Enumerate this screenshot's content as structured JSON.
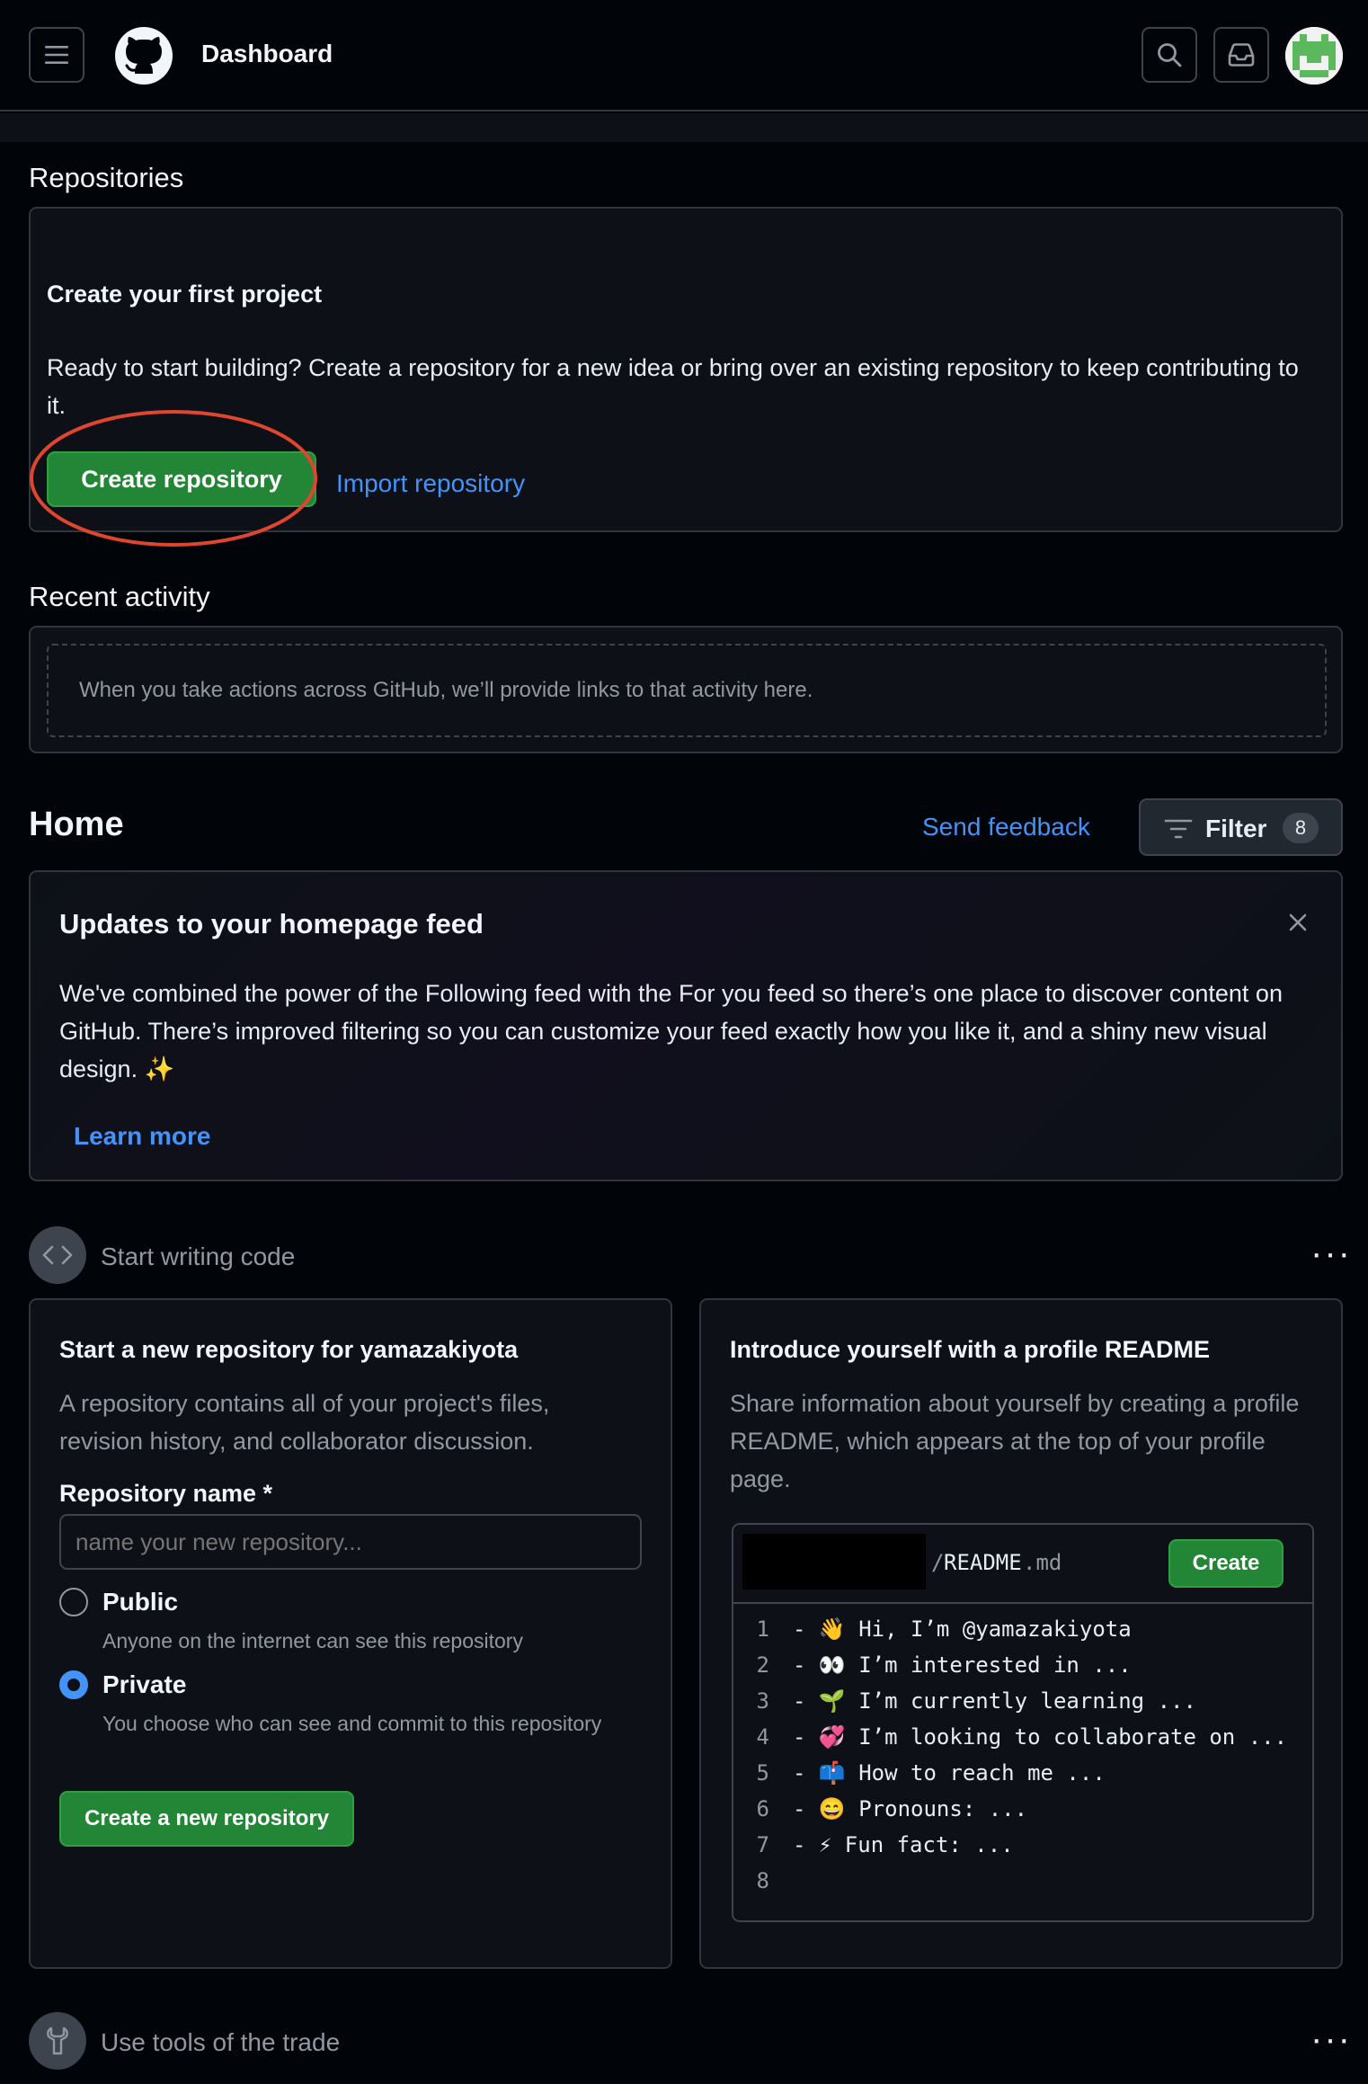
{
  "header": {
    "title": "Dashboard"
  },
  "repositories": {
    "heading": "Repositories",
    "card_title": "Create your first project",
    "card_text": "Ready to start building? Create a repository for a new idea or bring over an existing repository to keep contributing to it.",
    "create_button": "Create repository",
    "import_link": "Import repository"
  },
  "recent_activity": {
    "heading": "Recent activity",
    "empty_text": "When you take actions across GitHub, we’ll provide links to that activity here."
  },
  "home": {
    "heading": "Home",
    "feedback_link": "Send feedback",
    "filter_label": "Filter",
    "filter_count": "8"
  },
  "updates": {
    "title": "Updates to your homepage feed",
    "text": "We've combined the power of the Following feed with the For you feed so there’s one place to discover content on GitHub. There’s improved filtering so you can customize your feed exactly how you like it, and a shiny new visual design. ✨",
    "learn_more": "Learn more"
  },
  "start_writing": {
    "label": "Start writing code"
  },
  "new_repo": {
    "title": "Start a new repository for yamazakiyota",
    "description": "A repository contains all of your project's files, revision history, and collaborator discussion.",
    "name_label": "Repository name *",
    "name_placeholder": "name your new repository...",
    "public_label": "Public",
    "public_desc": "Anyone on the internet can see this repository",
    "private_label": "Private",
    "private_desc": "You choose who can see and commit to this repository",
    "selected_visibility": "Private",
    "create_button": "Create a new repository"
  },
  "readme": {
    "title": "Introduce yourself with a profile README",
    "description": "Share information about yourself by creating a profile README, which appears at the top of your profile page.",
    "path_sep": "/",
    "file_name": "README",
    "file_ext": ".md",
    "create_button": "Create",
    "lines": [
      {
        "n": "1",
        "text": "- 👋 Hi, I’m @yamazakiyota"
      },
      {
        "n": "2",
        "text": "- 👀 I’m interested in ..."
      },
      {
        "n": "3",
        "text": "- 🌱 I’m currently learning ..."
      },
      {
        "n": "4",
        "text": "- 💞️ I’m looking to collaborate on ..."
      },
      {
        "n": "5",
        "text": "- 📫 How to reach me ..."
      },
      {
        "n": "6",
        "text": "- 😄 Pronouns: ..."
      },
      {
        "n": "7",
        "text": "- ⚡ Fun fact: ..."
      },
      {
        "n": "8",
        "text": ""
      }
    ]
  },
  "tools": {
    "label": "Use tools of the trade"
  },
  "colors": {
    "accent_green": "#238636",
    "link_blue": "#4493f8",
    "annotation_red": "#e0452f"
  }
}
